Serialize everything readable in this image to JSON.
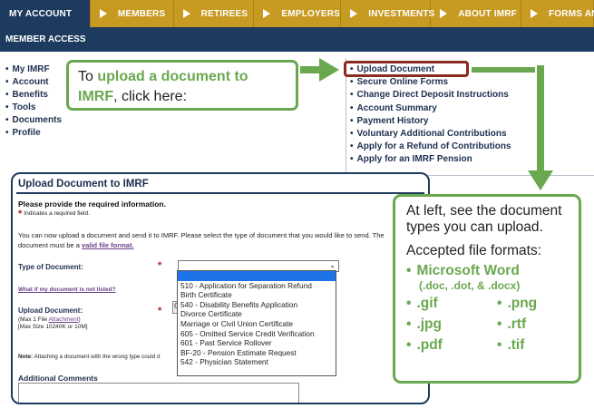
{
  "topnav": {
    "active": "MY ACCOUNT",
    "tabs": [
      "MEMBERS",
      "RETIREES",
      "EMPLOYERS",
      "INVESTMENTS",
      "ABOUT IMRF",
      "FORMS AND"
    ]
  },
  "subbar": {
    "title": "MEMBER ACCESS"
  },
  "left_links": [
    "My IMRF",
    "Account",
    "Benefits",
    "Tools",
    "Documents",
    "Profile"
  ],
  "right_links": [
    "Upload Document",
    "Secure Online Forms",
    "Change Direct Deposit Instructions",
    "Account Summary",
    "Payment History",
    "Voluntary Additional Contributions",
    "Apply for a Refund of Contributions",
    "Apply for an IMRF Pension"
  ],
  "callout_upload": {
    "part1": "To ",
    "highlight1": "upload a document to",
    "highlight2": "IMRF",
    "part2": ", click here:"
  },
  "callout_formats": {
    "intro": "At left, see the document types you can upload.",
    "title": "Accepted file formats:",
    "word": "Microsoft Word",
    "word_ext": "(.doc, .dot, & .docx)",
    "formats": [
      ".gif",
      ".png",
      ".jpg",
      ".rtf",
      ".pdf",
      ".tif"
    ]
  },
  "panel": {
    "title": "Upload Document to IMRF",
    "required_info": "Please provide the required information.",
    "required_note": "Indicates a required field.",
    "intro_text": "You can now upload a document and send it to IMRF. Please select the type of document that you would like to send. The document must be a ",
    "intro_link": "valid file format.",
    "type_label": "Type of Document:",
    "not_listed": "What if my document is not listed?",
    "upload_label": "Upload Document:",
    "max_file_prefix": "(Max 1 File ",
    "max_file_link": "Attachment",
    "max_file_suffix": ")",
    "max_size": "[Max Size 10240K or 10M]",
    "browse_label": "C",
    "note_label": "Note:",
    "note_text": " Attaching a document with the wrong type could d",
    "comments_label": "Additional Comments",
    "select_value": "",
    "dropdown_options": [
      "",
      "510 - Application for Separation Refund",
      "Birth Certificate",
      "540 - Disability Benefits Application",
      "Divorce Certificate",
      "Marriage or Civil Union Certificate",
      "605 - Omitted Service Credit Verification",
      "601 - Past Service Rollover",
      "BF-20 - Pension Estimate Request",
      "542 - Physician Statement"
    ]
  },
  "colors": {
    "navy": "#1d3a5f",
    "gold": "#c79a22",
    "green": "#6aa84f",
    "highlight": "#8b2a1f",
    "link_purple": "#6b3f8a"
  }
}
